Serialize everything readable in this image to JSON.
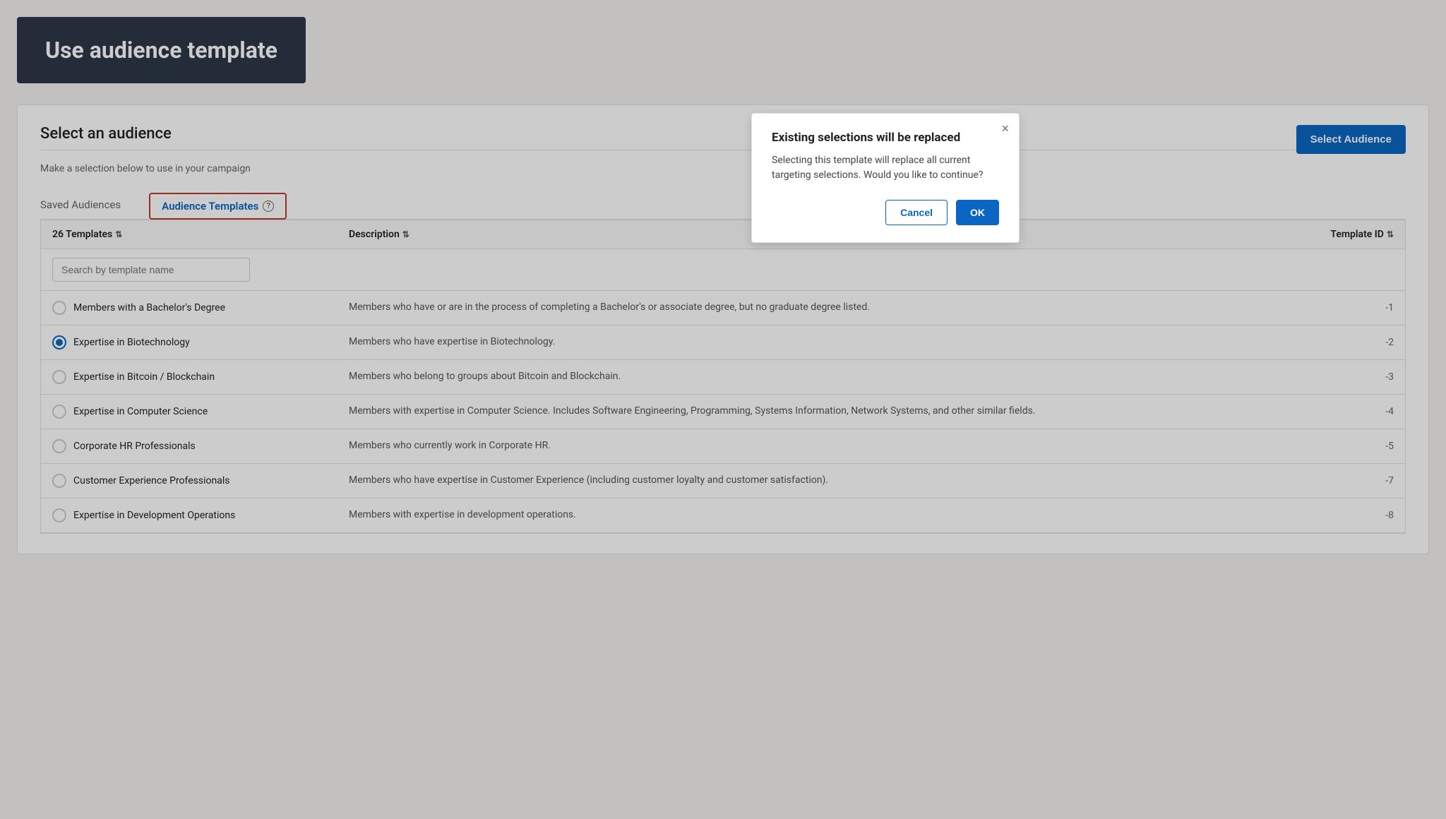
{
  "header": {
    "title": "Use audience template"
  },
  "section": {
    "title": "Select an audience",
    "subtitle": "Make a selection below to use in your campaign",
    "select_button": "Select Audience"
  },
  "tabs": [
    {
      "id": "saved",
      "label": "Saved Audiences",
      "active": false
    },
    {
      "id": "templates",
      "label": "Audience Templates",
      "active": true
    }
  ],
  "table": {
    "columns": [
      {
        "label": "26 Templates",
        "sort": true
      },
      {
        "label": "Description",
        "sort": true
      },
      {
        "label": "Template ID",
        "sort": true
      }
    ],
    "search_placeholder": "Search by template name",
    "rows": [
      {
        "name": "Members with a Bachelor's Degree",
        "description": "Members who have or are in the process of completing a Bachelor's or associate degree, but no graduate degree listed.",
        "id": "-1",
        "selected": false
      },
      {
        "name": "Expertise in Biotechnology",
        "description": "Members who have expertise in Biotechnology.",
        "id": "-2",
        "selected": true
      },
      {
        "name": "Expertise in Bitcoin / Blockchain",
        "description": "Members who belong to groups about Bitcoin and Blockchain.",
        "id": "-3",
        "selected": false
      },
      {
        "name": "Expertise in Computer Science",
        "description": "Members with expertise in Computer Science. Includes Software Engineering, Programming, Systems Information, Network Systems, and other similar fields.",
        "id": "-4",
        "selected": false
      },
      {
        "name": "Corporate HR Professionals",
        "description": "Members who currently work in Corporate HR.",
        "id": "-5",
        "selected": false
      },
      {
        "name": "Customer Experience Professionals",
        "description": "Members who have expertise in Customer Experience (including customer loyalty and customer satisfaction).",
        "id": "-7",
        "selected": false
      },
      {
        "name": "Expertise in Development Operations",
        "description": "Members with expertise in development operations.",
        "id": "-8",
        "selected": false
      }
    ]
  },
  "modal": {
    "title": "Existing selections will be replaced",
    "body": "Selecting this template will replace all current targeting selections. Would you like to continue?",
    "cancel_label": "Cancel",
    "ok_label": "OK",
    "close_icon": "×"
  },
  "colors": {
    "primary": "#0a66c2",
    "danger": "#c0392b",
    "header_bg": "#2d3748",
    "text_primary": "#1d2226",
    "text_secondary": "#666"
  }
}
